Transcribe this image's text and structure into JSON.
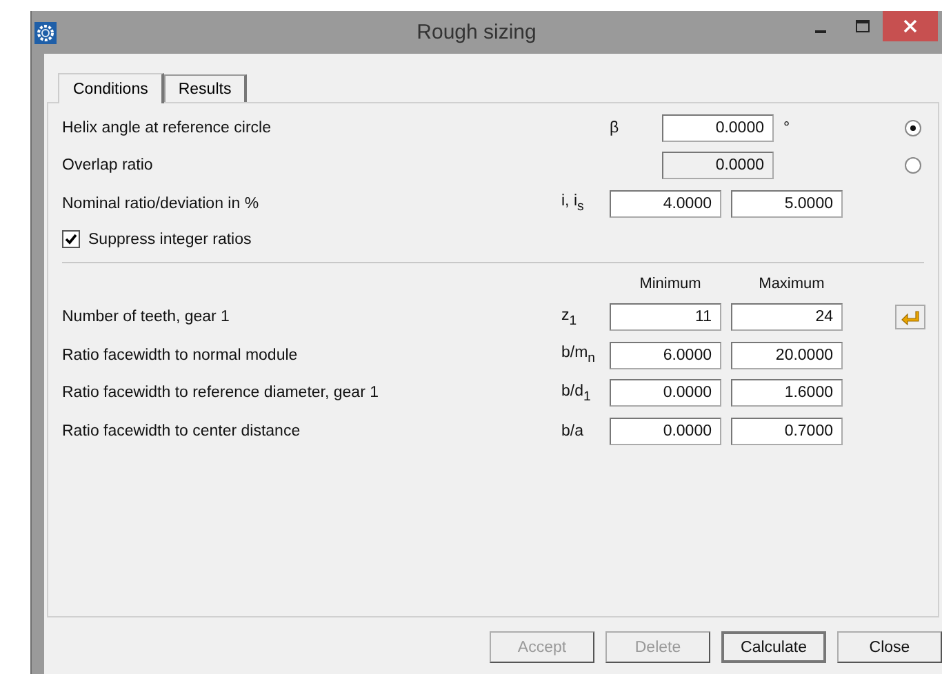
{
  "window": {
    "title": "Rough sizing"
  },
  "tabs": [
    {
      "label": "Conditions",
      "selected": true
    },
    {
      "label": "Results",
      "selected": false
    }
  ],
  "top_rows": [
    {
      "label": "Helix angle at reference circle",
      "symbol": "β",
      "value": "0.0000",
      "disabled": false,
      "unit": "°",
      "selected": true
    },
    {
      "label": "Overlap ratio",
      "value": "0.0000",
      "disabled": true,
      "selected": false
    }
  ],
  "ratio_row": {
    "label": "Nominal ratio/deviation in %",
    "symbol": "i, i$_{s}$",
    "values": [
      "4.0000",
      "5.0000"
    ]
  },
  "checkbox": {
    "label": "Suppress integer ratios",
    "checked": true
  },
  "columns": [
    "Minimum",
    "Maximum"
  ],
  "range_rows": [
    {
      "label": "Number of teeth, gear 1",
      "symbol": "z$_{1}$",
      "values": [
        "11",
        "24"
      ],
      "apply_button": true
    },
    {
      "label": "Ratio facewidth to normal module",
      "symbol": "b/m$_{n}$",
      "values": [
        "6.0000",
        "20.0000"
      ],
      "apply_button": false
    },
    {
      "label": "Ratio facewidth to reference diameter, gear 1",
      "symbol": "b/d$_{1}$",
      "values": [
        "0.0000",
        "1.6000"
      ],
      "apply_button": false
    },
    {
      "label": "Ratio facewidth to center distance",
      "symbol": "b/a",
      "values": [
        "0.0000",
        "0.7000"
      ],
      "apply_button": false
    }
  ],
  "buttons": [
    {
      "label": "Accept",
      "disabled": true,
      "default": false
    },
    {
      "label": "Delete",
      "disabled": true,
      "default": false
    },
    {
      "label": "Calculate",
      "disabled": false,
      "default": true
    },
    {
      "label": "Close",
      "disabled": false,
      "default": false
    }
  ]
}
